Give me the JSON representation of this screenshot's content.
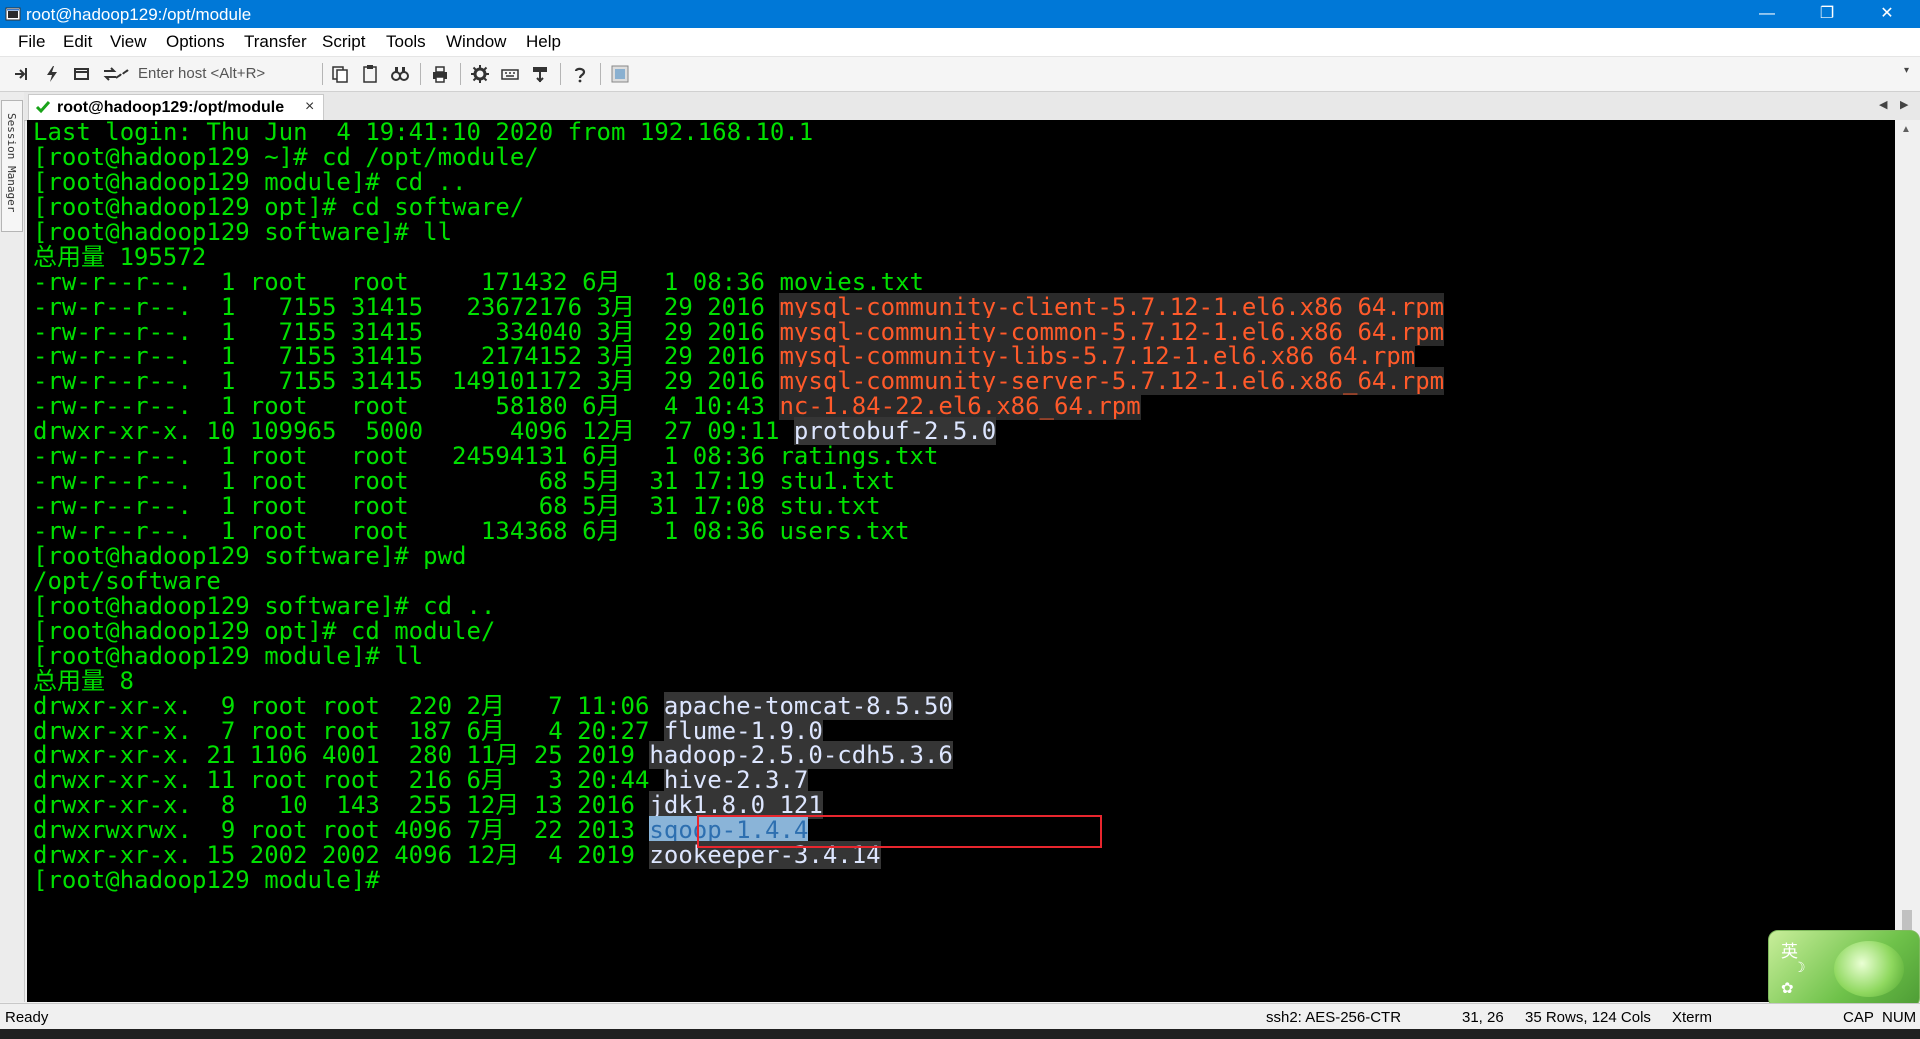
{
  "window": {
    "title": "root@hadoop129:/opt/module",
    "minimize": "—",
    "maximize": "❐",
    "close": "✕"
  },
  "menu": [
    "File",
    "Edit",
    "View",
    "Options",
    "Transfer",
    "Script",
    "Tools",
    "Window",
    "Help"
  ],
  "toolbar": {
    "host_placeholder": "Enter host <Alt+R>"
  },
  "session_manager": "Session Manager",
  "tab": {
    "label": "root@hadoop129:/opt/module",
    "close": "×"
  },
  "terminal": {
    "lines": [
      [
        {
          "t": "Last login: Thu Jun  4 19:41:10 2020 from 192.168.10.1"
        }
      ],
      [
        {
          "t": "[root@hadoop129 ~]# cd /opt/module/"
        }
      ],
      [
        {
          "t": "[root@hadoop129 module]# cd .."
        }
      ],
      [
        {
          "t": "[root@hadoop129 opt]# cd software/"
        }
      ],
      [
        {
          "t": "[root@hadoop129 software]# ll"
        }
      ],
      [
        {
          "t": "总用量 195572"
        }
      ],
      [
        {
          "t": "-rw-r--r--.  1 root   root     171432 6月   1 08:36 "
        },
        {
          "t": "movies.txt"
        }
      ],
      [
        {
          "t": "-rw-r--r--.  1   7155 31415   23672176 3月  29 2016 "
        },
        {
          "t": "mysql-community-client-5.7.12-1.el6.x86_64.rpm",
          "c": "hl-red"
        }
      ],
      [
        {
          "t": "-rw-r--r--.  1   7155 31415     334040 3月  29 2016 "
        },
        {
          "t": "mysql-community-common-5.7.12-1.el6.x86_64.rpm",
          "c": "hl-red"
        }
      ],
      [
        {
          "t": "-rw-r--r--.  1   7155 31415    2174152 3月  29 2016 "
        },
        {
          "t": "mysql-community-libs-5.7.12-1.el6.x86_64.rpm",
          "c": "hl-red"
        }
      ],
      [
        {
          "t": "-rw-r--r--.  1   7155 31415  149101172 3月  29 2016 "
        },
        {
          "t": "mysql-community-server-5.7.12-1.el6.x86_64.rpm",
          "c": "hl-red"
        }
      ],
      [
        {
          "t": "-rw-r--r--.  1 root   root      58180 6月   4 10:43 "
        },
        {
          "t": "nc-1.84-22.el6.x86_64.rpm",
          "c": "hl-red"
        }
      ],
      [
        {
          "t": "drwxr-xr-x. 10 109965  5000      4096 12月  27 09:11 "
        },
        {
          "t": "protobuf-2.5.0",
          "c": "hl-blue"
        }
      ],
      [
        {
          "t": "-rw-r--r--.  1 root   root   24594131 6月   1 08:36 "
        },
        {
          "t": "ratings.txt"
        }
      ],
      [
        {
          "t": "-rw-r--r--.  1 root   root         68 5月  31 17:19 "
        },
        {
          "t": "stu1.txt"
        }
      ],
      [
        {
          "t": "-rw-r--r--.  1 root   root         68 5月  31 17:08 "
        },
        {
          "t": "stu.txt"
        }
      ],
      [
        {
          "t": "-rw-r--r--.  1 root   root     134368 6月   1 08:36 "
        },
        {
          "t": "users.txt"
        }
      ],
      [
        {
          "t": "[root@hadoop129 software]# pwd"
        }
      ],
      [
        {
          "t": "/opt/software"
        }
      ],
      [
        {
          "t": "[root@hadoop129 software]# cd .."
        }
      ],
      [
        {
          "t": "[root@hadoop129 opt]# cd module/"
        }
      ],
      [
        {
          "t": "[root@hadoop129 module]# ll"
        }
      ],
      [
        {
          "t": "总用量 8"
        }
      ],
      [
        {
          "t": "drwxr-xr-x.  9 root root  220 2月   7 11:06 "
        },
        {
          "t": "apache-tomcat-8.5.50",
          "c": "hl-blue"
        }
      ],
      [
        {
          "t": "drwxr-xr-x.  7 root root  187 6月   4 20:27 "
        },
        {
          "t": "flume-1.9.0",
          "c": "hl-blue"
        }
      ],
      [
        {
          "t": "drwxr-xr-x. 21 1106 4001  280 11月 25 2019 "
        },
        {
          "t": "hadoop-2.5.0-cdh5.3.6",
          "c": "hl-blue"
        }
      ],
      [
        {
          "t": "drwxr-xr-x. 11 root root  216 6月   3 20:44 "
        },
        {
          "t": "hive-2.3.7",
          "c": "hl-blue"
        }
      ],
      [
        {
          "t": "drwxr-xr-x.  8   10  143  255 12月 13 2016 "
        },
        {
          "t": "jdk1.8.0_121",
          "c": "hl-blue"
        }
      ],
      [
        {
          "t": "drwxrwxrwx.  9 root root 4096 7月  22 2013 "
        },
        {
          "t": "sqoop-1.4.4",
          "c": "hl-sel"
        }
      ],
      [
        {
          "t": "drwxr-xr-x. 15 2002 2002 4096 12月  4 2019 "
        },
        {
          "t": "zookeeper-3.4.14",
          "c": "hl-blue"
        }
      ],
      [
        {
          "t": "[root@hadoop129 module]#"
        }
      ]
    ]
  },
  "ime": {
    "lang": "英",
    "moon": "☽",
    "gear": "✿"
  },
  "status": {
    "ready": "Ready",
    "cipher": "ssh2: AES-256-CTR",
    "cursor": "31,  26",
    "size": "35 Rows, 124 Cols",
    "term_type": "Xterm",
    "caps": "CAP",
    "num": "NUM"
  },
  "colors": {
    "title_bar": "#0078d7",
    "terminal_fg": "#00e000",
    "terminal_bg": "#000000",
    "rpm_highlight": "#ff5a2a",
    "dir_highlight": "#dde6ff",
    "annotation_box": "#e8262e"
  }
}
